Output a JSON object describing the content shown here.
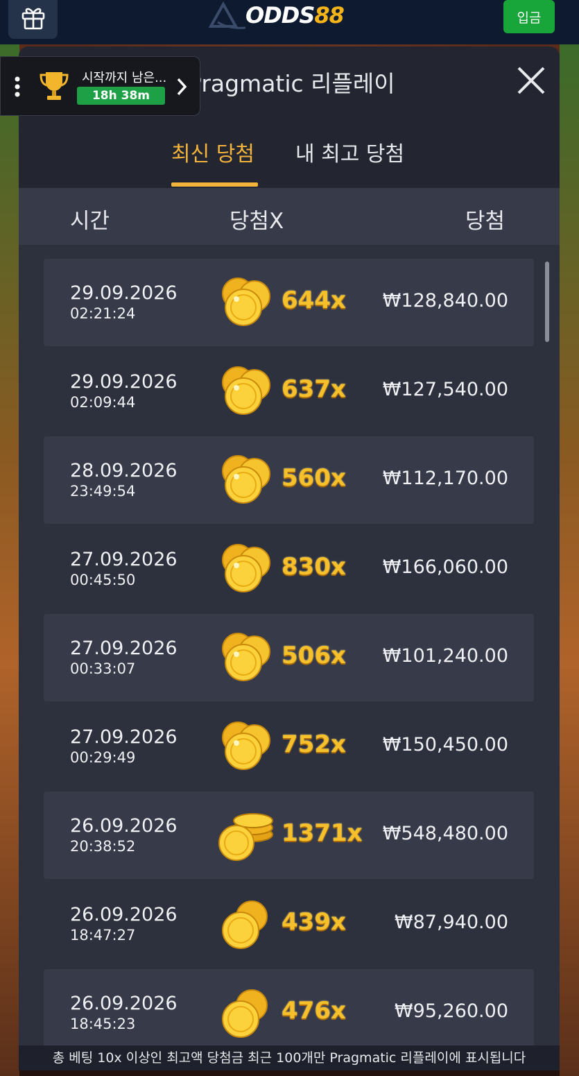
{
  "header": {
    "logo_text": "ODDS",
    "logo_num": "88",
    "deposit_label": "입금"
  },
  "tournament": {
    "label": "시작까지 남은...",
    "timer": "18h 38m"
  },
  "modal": {
    "title": "Pragmatic 리플레이",
    "tabs": [
      {
        "label": "최신 당첨",
        "active": true
      },
      {
        "label": "내 최고 당첨",
        "active": false
      }
    ],
    "columns": {
      "time": "시간",
      "multiplier": "당첨X",
      "win": "당첨"
    },
    "rows": [
      {
        "date": "29.09.2026",
        "time": "02:21:24",
        "multiplier": "644x",
        "win": "₩128,840.00",
        "coins": "coin-pile"
      },
      {
        "date": "29.09.2026",
        "time": "02:09:44",
        "multiplier": "637x",
        "win": "₩127,540.00",
        "coins": "coin-pile"
      },
      {
        "date": "28.09.2026",
        "time": "23:49:54",
        "multiplier": "560x",
        "win": "₩112,170.00",
        "coins": "coin-pile"
      },
      {
        "date": "27.09.2026",
        "time": "00:45:50",
        "multiplier": "830x",
        "win": "₩166,060.00",
        "coins": "coin-pile"
      },
      {
        "date": "27.09.2026",
        "time": "00:33:07",
        "multiplier": "506x",
        "win": "₩101,240.00",
        "coins": "coin-pile"
      },
      {
        "date": "27.09.2026",
        "time": "00:29:49",
        "multiplier": "752x",
        "win": "₩150,450.00",
        "coins": "coin-pile"
      },
      {
        "date": "26.09.2026",
        "time": "20:38:52",
        "multiplier": "1371x",
        "win": "₩548,480.00",
        "coins": "coin-stack"
      },
      {
        "date": "26.09.2026",
        "time": "18:47:27",
        "multiplier": "439x",
        "win": "₩87,940.00",
        "coins": "coin-pair"
      },
      {
        "date": "26.09.2026",
        "time": "18:45:23",
        "multiplier": "476x",
        "win": "₩95,260.00",
        "coins": "coin-pair"
      }
    ],
    "footer": "총 베팅 10x 이상인 최고액 당첨금 최근 100개만 Pragmatic 리플레이에 표시됩니다"
  },
  "colors": {
    "accent": "#f4b43b",
    "deposit": "#18a53a",
    "timer": "#1ea046",
    "multiplier": "#f6c02c"
  }
}
